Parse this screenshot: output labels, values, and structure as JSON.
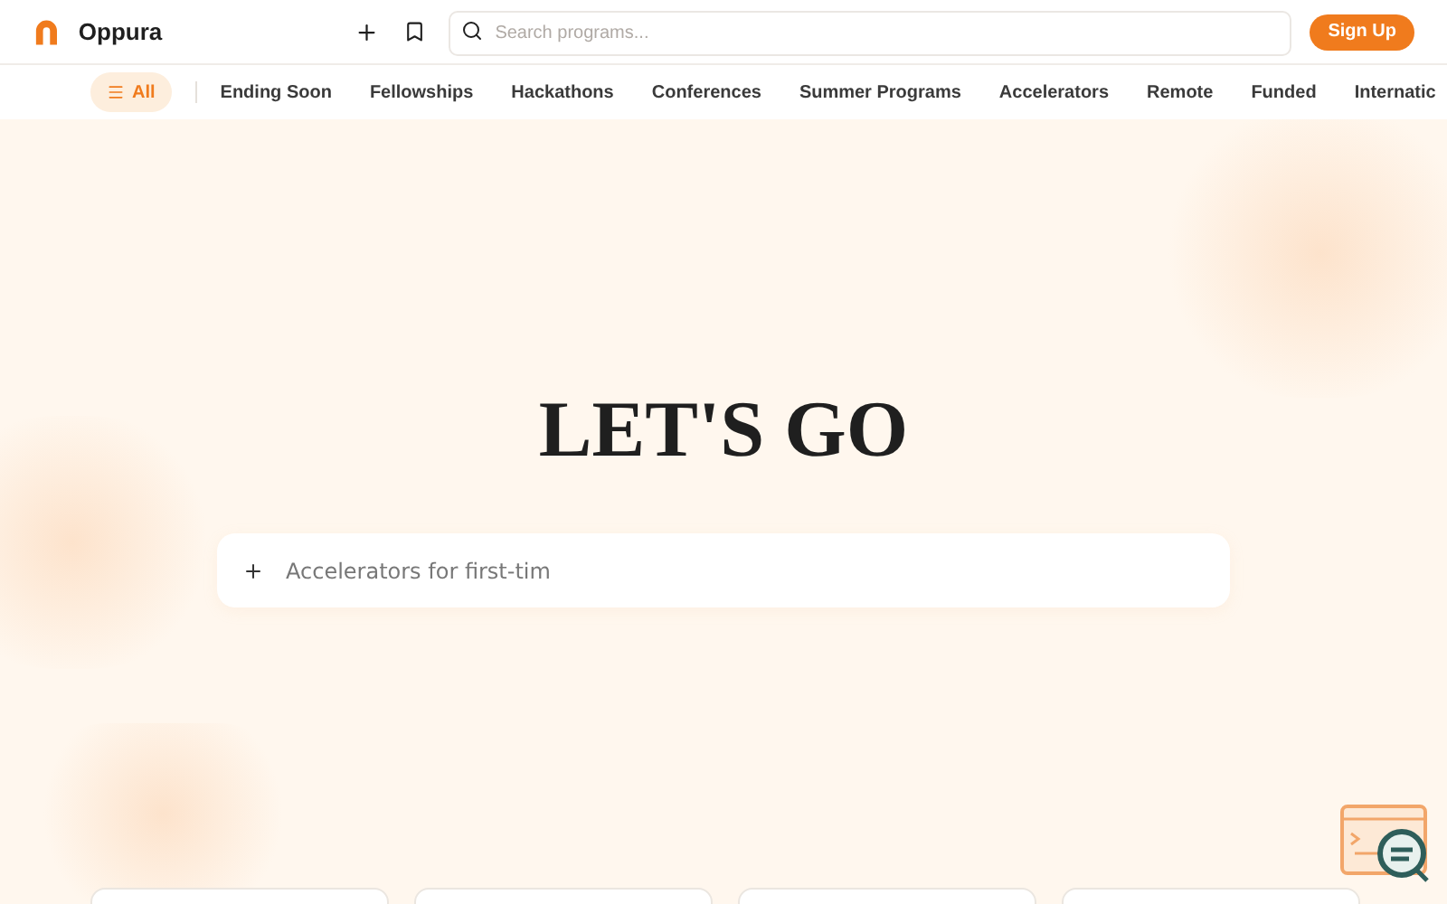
{
  "header": {
    "brand": "Oppura",
    "search": {
      "placeholder": "Search programs..."
    },
    "sign_up": "Sign Up"
  },
  "categories": [
    {
      "label": "All",
      "selected": true
    },
    {
      "label": "Ending Soon",
      "selected": false
    },
    {
      "label": "Fellowships",
      "selected": false
    },
    {
      "label": "Hackathons",
      "selected": false
    },
    {
      "label": "Conferences",
      "selected": false
    },
    {
      "label": "Summer Programs",
      "selected": false
    },
    {
      "label": "Accelerators",
      "selected": false
    },
    {
      "label": "Remote",
      "selected": false
    },
    {
      "label": "Funded",
      "selected": false
    },
    {
      "label": "Internatic",
      "selected": false
    }
  ],
  "hero": {
    "title": "LET'S GO",
    "prompt": {
      "value": "Accelerators for first-tim"
    }
  },
  "cards": [
    {
      "kind": "card"
    },
    {
      "kind": "card"
    },
    {
      "kind": "card"
    },
    {
      "kind": "card"
    }
  ]
}
